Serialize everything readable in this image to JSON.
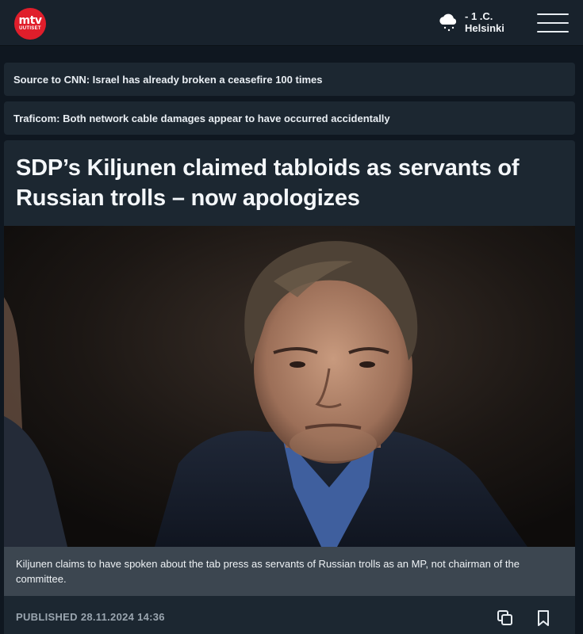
{
  "header": {
    "logo_text": "mtv",
    "logo_subtext": "UUTISET",
    "weather": {
      "icon": "cloud-snow-icon",
      "temperature": "- 1 .C.",
      "city": "Helsinki"
    },
    "menu_icon": "hamburger-menu-icon"
  },
  "news_ticker": [
    {
      "text": "Source to CNN: Israel has already broken a ceasefire 100 times"
    },
    {
      "text": "Traficom: Both network cable damages appear to have occurred accidentally"
    }
  ],
  "article": {
    "headline": "SDP’s Kiljunen claimed tabloids as servants of Russian trolls – now apologizes",
    "caption": "Kiljunen claims to have spoken about the tab press as servants of Russian trolls as an MP, not chairman of the committee.",
    "published_label": "PUBLISHED",
    "published_date": "28.11.2024 14:36",
    "actions": [
      "copy-icon",
      "bookmark-icon"
    ]
  },
  "colors": {
    "brand_red": "#e01e2b",
    "background": "#0f1720",
    "card": "#1c2731",
    "caption_bg": "#3c4650",
    "meta_text": "#9aa5af"
  }
}
